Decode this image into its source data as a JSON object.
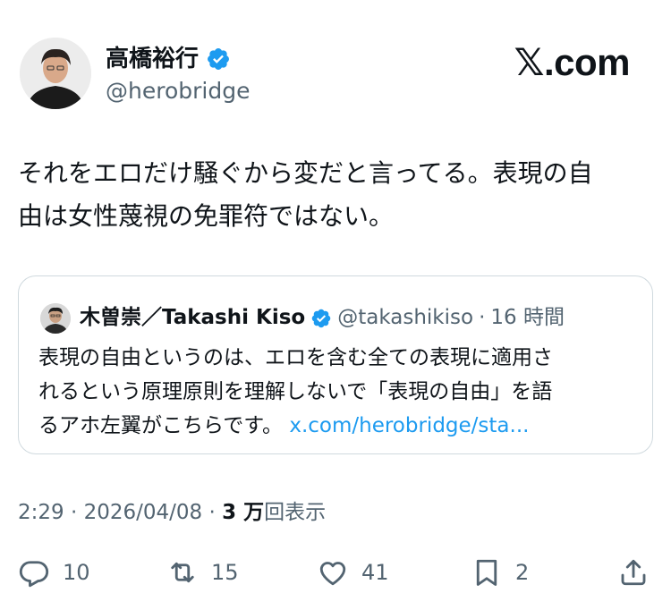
{
  "tweet": {
    "author_name": "高橋裕行",
    "author_handle": "@herobridge",
    "brand": "𝕏.com",
    "text": "それをエロだけ騒ぐから変だと言ってる。表現の自\n由は女性蔑視の免罪符ではない。"
  },
  "quote": {
    "author_name": "木曽崇／Takashi Kiso",
    "author_handle": "@takashikiso",
    "separator": "·",
    "time": "16 時間",
    "text": "表現の自由というのは、エロを含む全ての表現に適用さ\nれるという原理原則を理解しないで「表現の自由」を語\nるアホ左翼がこちらです。 ",
    "link": "x.com/herobridge/sta..."
  },
  "meta": {
    "time": "2:29",
    "separator": " · ",
    "date": "2026/04/08",
    "views_count": "3 万",
    "views_label": "回表示"
  },
  "actions": {
    "replies": "10",
    "retweets": "15",
    "likes": "41",
    "bookmarks": "2"
  },
  "icons": {
    "verified": "verified-badge-icon",
    "reply": "reply-icon",
    "retweet": "retweet-icon",
    "like": "heart-icon",
    "bookmark": "bookmark-icon",
    "share": "share-icon"
  },
  "colors": {
    "verified": "#1d9bf0",
    "link": "#1d9bf0",
    "muted": "#536471",
    "text": "#0f1419",
    "border": "#cfd9de"
  }
}
